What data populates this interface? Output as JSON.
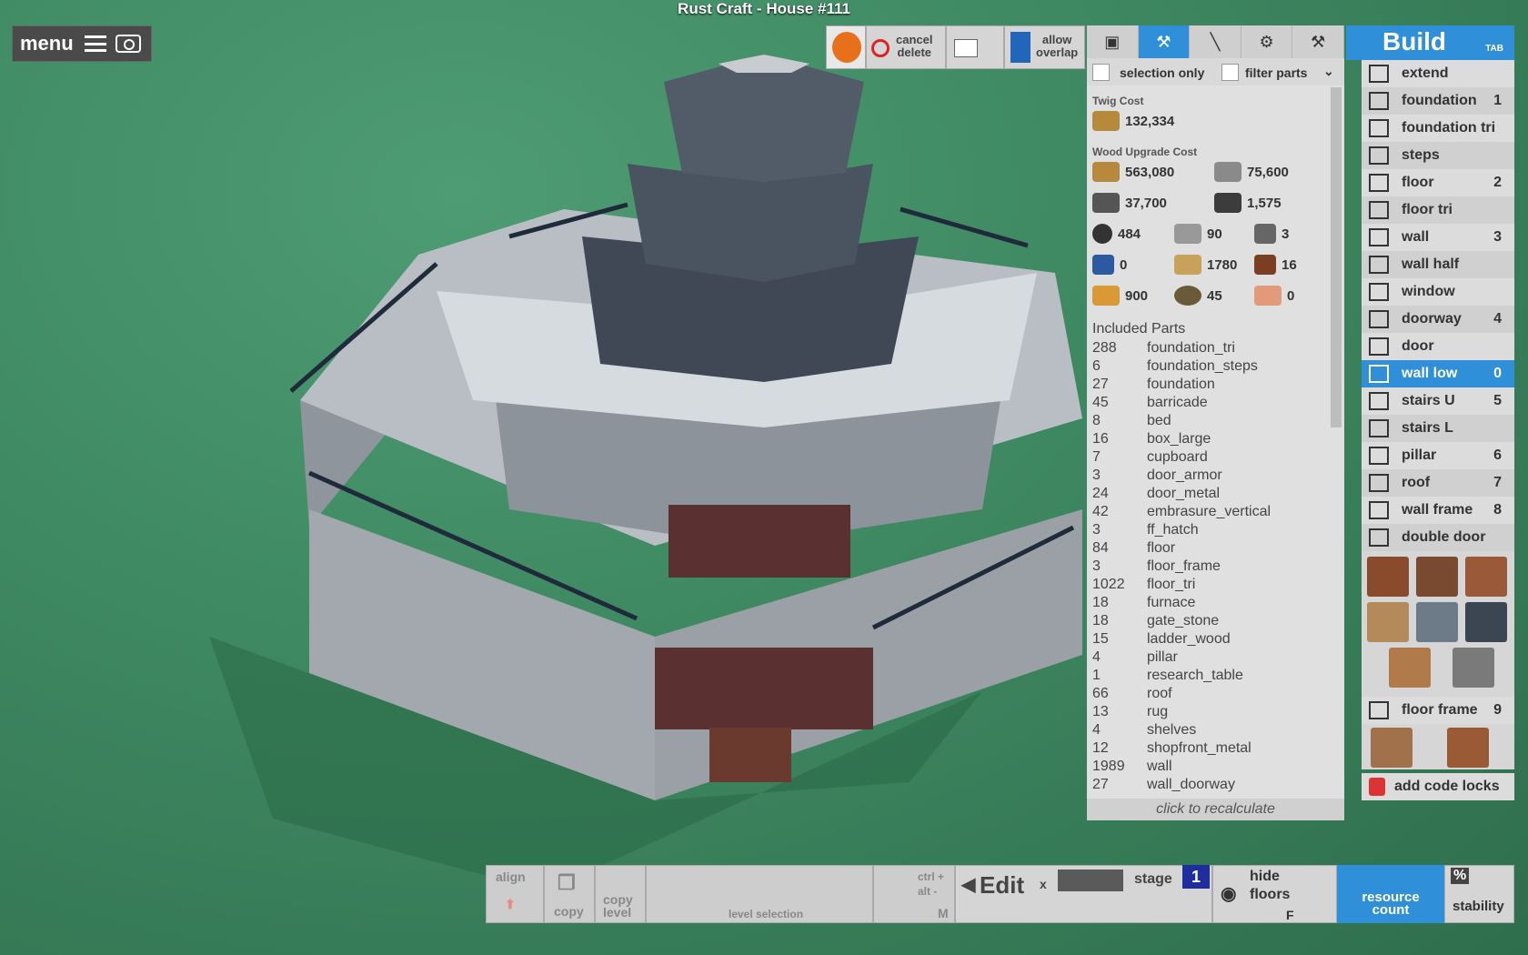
{
  "window_title": "Rust Craft - House #111",
  "menu": {
    "label": "menu"
  },
  "toolbar": {
    "cancel_delete": "cancel\ndelete",
    "allow_overlap": "allow\noverlap",
    "selection_only": "selection only",
    "filter_parts": "filter parts"
  },
  "cost": {
    "twig_title": "Twig Cost",
    "twig_value": "132,334",
    "wood_title": "Wood Upgrade Cost",
    "resources": [
      "563,080",
      "75,600",
      "37,700",
      "1,575",
      "484",
      "90",
      "3",
      "0",
      "1780",
      "16",
      "900",
      "45",
      "0"
    ],
    "included_title": "Included Parts",
    "parts": [
      {
        "n": "288",
        "p": "foundation_tri"
      },
      {
        "n": "6",
        "p": "foundation_steps"
      },
      {
        "n": "27",
        "p": "foundation"
      },
      {
        "n": "45",
        "p": "barricade"
      },
      {
        "n": "8",
        "p": "bed"
      },
      {
        "n": "16",
        "p": "box_large"
      },
      {
        "n": "7",
        "p": "cupboard"
      },
      {
        "n": "3",
        "p": "door_armor"
      },
      {
        "n": "24",
        "p": "door_metal"
      },
      {
        "n": "42",
        "p": "embrasure_vertical"
      },
      {
        "n": "3",
        "p": "ff_hatch"
      },
      {
        "n": "84",
        "p": "floor"
      },
      {
        "n": "3",
        "p": "floor_frame"
      },
      {
        "n": "1022",
        "p": "floor_tri"
      },
      {
        "n": "18",
        "p": "furnace"
      },
      {
        "n": "18",
        "p": "gate_stone"
      },
      {
        "n": "15",
        "p": "ladder_wood"
      },
      {
        "n": "4",
        "p": "pillar"
      },
      {
        "n": "1",
        "p": "research_table"
      },
      {
        "n": "66",
        "p": "roof"
      },
      {
        "n": "13",
        "p": "rug"
      },
      {
        "n": "4",
        "p": "shelves"
      },
      {
        "n": "12",
        "p": "shopfront_metal"
      },
      {
        "n": "1989",
        "p": "wall"
      },
      {
        "n": "27",
        "p": "wall_doorway"
      }
    ],
    "recalc": "click to recalculate"
  },
  "build": {
    "title": "Build",
    "tab_hint": "TAB",
    "items": [
      {
        "label": "extend",
        "key": ""
      },
      {
        "label": "foundation",
        "key": "1"
      },
      {
        "label": "foundation tri",
        "key": ""
      },
      {
        "label": "steps",
        "key": ""
      },
      {
        "label": "floor",
        "key": "2"
      },
      {
        "label": "floor tri",
        "key": ""
      },
      {
        "label": "wall",
        "key": "3"
      },
      {
        "label": "wall half",
        "key": ""
      },
      {
        "label": "window",
        "key": ""
      },
      {
        "label": "doorway",
        "key": "4"
      },
      {
        "label": "door",
        "key": ""
      },
      {
        "label": "wall low",
        "key": "0"
      },
      {
        "label": "stairs U",
        "key": "5"
      },
      {
        "label": "stairs L",
        "key": ""
      },
      {
        "label": "pillar",
        "key": "6"
      },
      {
        "label": "roof",
        "key": "7"
      },
      {
        "label": "wall frame",
        "key": "8"
      },
      {
        "label": "double door",
        "key": ""
      }
    ],
    "floor_frame": {
      "label": "floor frame",
      "key": "9"
    },
    "add_code_locks": "add code locks"
  },
  "bottom": {
    "align": "align",
    "copy": "copy",
    "copy_level": "copy\nlevel",
    "level_selection": "level selection",
    "ctrl_alt": "ctrl +\nalt -",
    "m_key": "M",
    "edit": "Edit",
    "x": "x",
    "stage_label": "stage",
    "stage_value": "1",
    "hide_floors": "hide\nfloors",
    "f_key": "F",
    "resource_count": "resource\ncount",
    "percent": "%",
    "stability": "stability"
  }
}
